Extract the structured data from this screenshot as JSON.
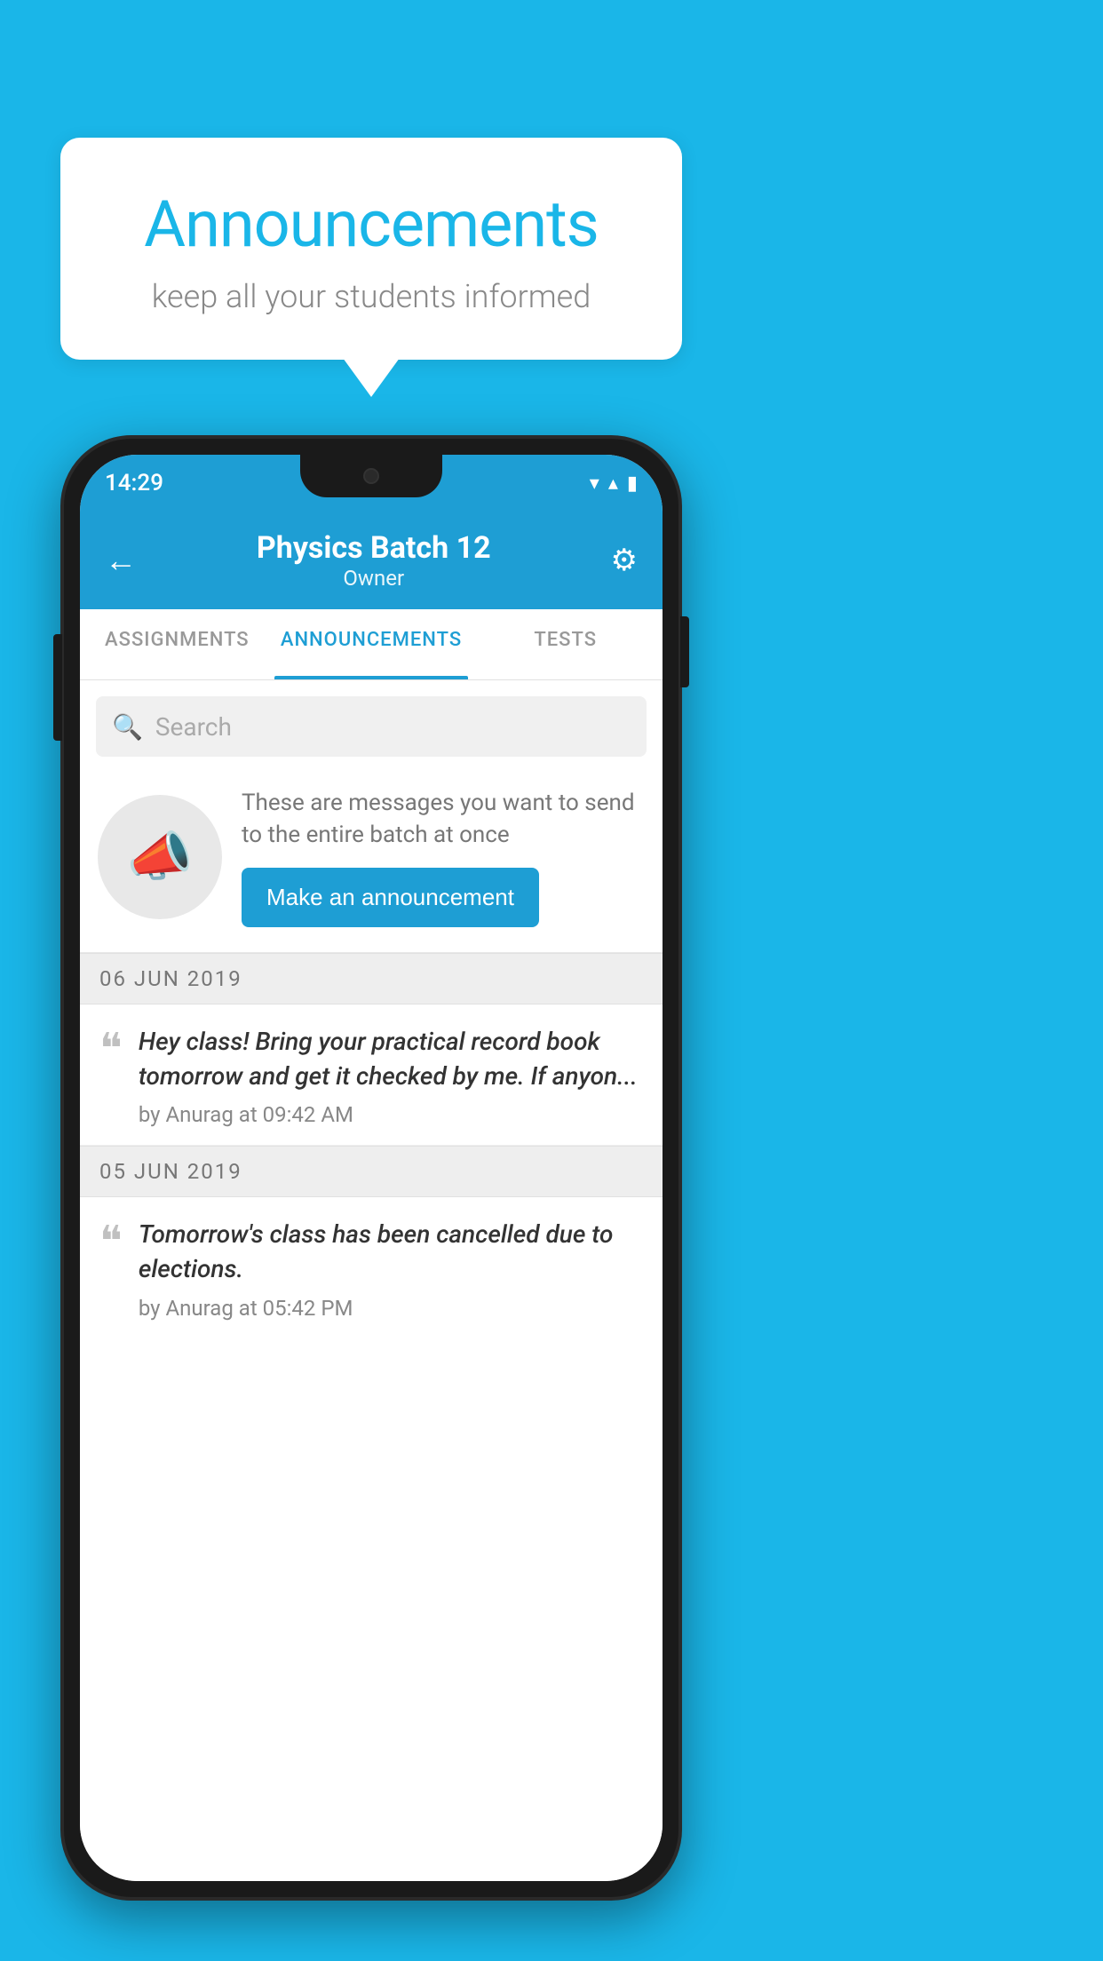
{
  "background_color": "#1ab6e8",
  "speech_bubble": {
    "title": "Announcements",
    "subtitle": "keep all your students informed"
  },
  "status_bar": {
    "time": "14:29",
    "wifi_icon": "▼",
    "signal_icon": "▲",
    "battery_icon": "▮"
  },
  "app_bar": {
    "back_label": "←",
    "title": "Physics Batch 12",
    "subtitle": "Owner",
    "settings_icon": "⚙"
  },
  "tabs": [
    {
      "label": "ASSIGNMENTS",
      "active": false
    },
    {
      "label": "ANNOUNCEMENTS",
      "active": true
    },
    {
      "label": "TESTS",
      "active": false
    }
  ],
  "search": {
    "placeholder": "Search"
  },
  "promo": {
    "description": "These are messages you want to send to the entire batch at once",
    "button_label": "Make an announcement"
  },
  "announcements": [
    {
      "date": "06  JUN  2019",
      "text": "Hey class! Bring your practical record book tomorrow and get it checked by me. If anyon...",
      "author": "by Anurag at 09:42 AM"
    },
    {
      "date": "05  JUN  2019",
      "text": "Tomorrow's class has been cancelled due to elections.",
      "author": "by Anurag at 05:42 PM"
    }
  ]
}
